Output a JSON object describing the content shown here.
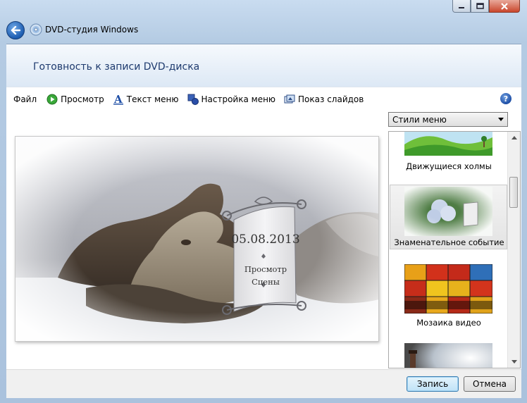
{
  "window": {
    "title": "DVD-студия Windows"
  },
  "header": {
    "title": "Готовность к записи DVD-диска"
  },
  "toolbar": {
    "file": "Файл",
    "preview": "Просмотр",
    "menu_text": "Текст меню",
    "menu_settings": "Настройка меню",
    "slideshow": "Показ слайдов"
  },
  "preview": {
    "date": "05.08.2013",
    "play": "Просмотр",
    "scenes": "Сцены"
  },
  "styles_panel": {
    "dropdown_value": "Стили меню",
    "items": [
      {
        "label": "Движущиеся холмы"
      },
      {
        "label": "Знаменательное событие"
      },
      {
        "label": "Мозаика видео"
      }
    ]
  },
  "buttons": {
    "burn": "Запись",
    "cancel": "Отмена"
  },
  "colors": {
    "accent": "#1e3a6e",
    "frame": "#b4cbe3",
    "close": "#c9462c"
  }
}
